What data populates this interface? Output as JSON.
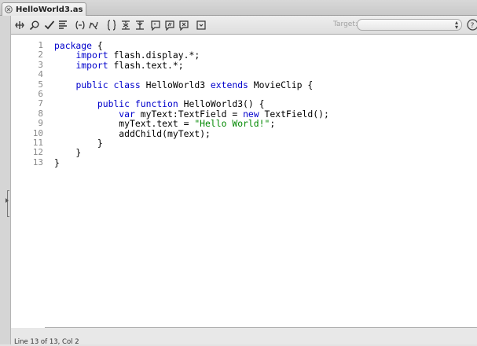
{
  "tab": {
    "title": "HelloWorld3.as"
  },
  "toolbar": {
    "buttons": [
      {
        "name": "add-item-icon"
      },
      {
        "name": "find-icon"
      },
      {
        "name": "check-syntax-icon"
      },
      {
        "name": "auto-format-icon"
      },
      {
        "name": "code-hint-icon"
      },
      {
        "name": "debug-options-icon"
      },
      {
        "name": "collapse-between-braces-icon"
      },
      {
        "name": "collapse-selection-icon"
      },
      {
        "name": "expand-all-icon"
      },
      {
        "name": "apply-block-comment-icon"
      },
      {
        "name": "apply-line-comment-icon"
      },
      {
        "name": "remove-comment-icon"
      },
      {
        "name": "show-hide-toolbox-icon"
      }
    ],
    "target_label": "Target:",
    "target_value": ""
  },
  "editor": {
    "line_numbers": [
      "1",
      "2",
      "3",
      "4",
      "5",
      "6",
      "7",
      "8",
      "9",
      "10",
      "11",
      "12",
      "13"
    ],
    "lines": [
      "package {",
      "    import flash.display.*;",
      "    import flash.text.*;",
      "",
      "    public class HelloWorld3 extends MovieClip {",
      "",
      "        public function HelloWorld3() {",
      "            var myText:TextField = new TextField();",
      "            myText.text = \"Hello World!\";",
      "            addChild(myText);",
      "        }",
      "    }",
      "}"
    ]
  },
  "status": {
    "text": "Line 13 of 13, Col 2"
  },
  "colors": {
    "keyword": "#0000cc",
    "string": "#008800",
    "line_number": "#888888"
  }
}
